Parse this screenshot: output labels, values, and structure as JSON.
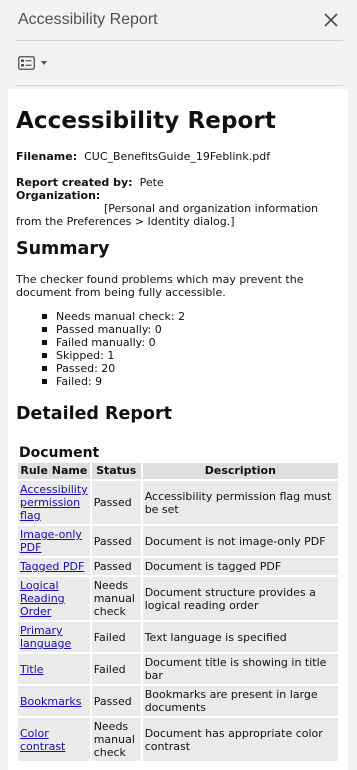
{
  "panel": {
    "title": "Accessibility Report",
    "close_glyph": "✕"
  },
  "toolbar": {
    "view_icon": "list-view-icon"
  },
  "report": {
    "title": "Accessibility Report",
    "filename_label": "Filename:",
    "filename": "CUC_BenefitsGuide_19Feblink.pdf",
    "created_by_label": "Report created by:",
    "created_by": "Pete",
    "organization_label": "Organization:",
    "organization_note": "[Personal and organization information from the Preferences > Identity dialog.]",
    "summary_heading": "Summary",
    "summary_text": "The checker found problems which may prevent the document from being fully accessible.",
    "summary_items": [
      "Needs manual check: 2",
      "Passed manually: 0",
      "Failed manually: 0",
      "Skipped: 1",
      "Passed: 20",
      "Failed: 9"
    ],
    "detail_heading": "Detailed Report",
    "section_heading": "Document",
    "table_headers": {
      "rule": "Rule Name",
      "status": "Status",
      "description": "Description"
    },
    "rows": [
      {
        "rule": "Accessibility permission flag",
        "status": "Passed",
        "description": "Accessibility permission flag must be set"
      },
      {
        "rule": "Image-only PDF",
        "status": "Passed",
        "description": "Document is not image-only PDF"
      },
      {
        "rule": "Tagged PDF",
        "status": "Passed",
        "description": "Document is tagged PDF"
      },
      {
        "rule": "Logical Reading Order",
        "status": "Needs manual check",
        "description": "Document structure provides a logical reading order"
      },
      {
        "rule": "Primary language",
        "status": "Failed",
        "description": "Text language is specified"
      },
      {
        "rule": "Title",
        "status": "Failed",
        "description": "Document title is showing in title bar"
      },
      {
        "rule": "Bookmarks",
        "status": "Passed",
        "description": "Bookmarks are present in large documents"
      },
      {
        "rule": "Color contrast",
        "status": "Needs manual check",
        "description": "Document has appropriate color contrast"
      }
    ]
  }
}
